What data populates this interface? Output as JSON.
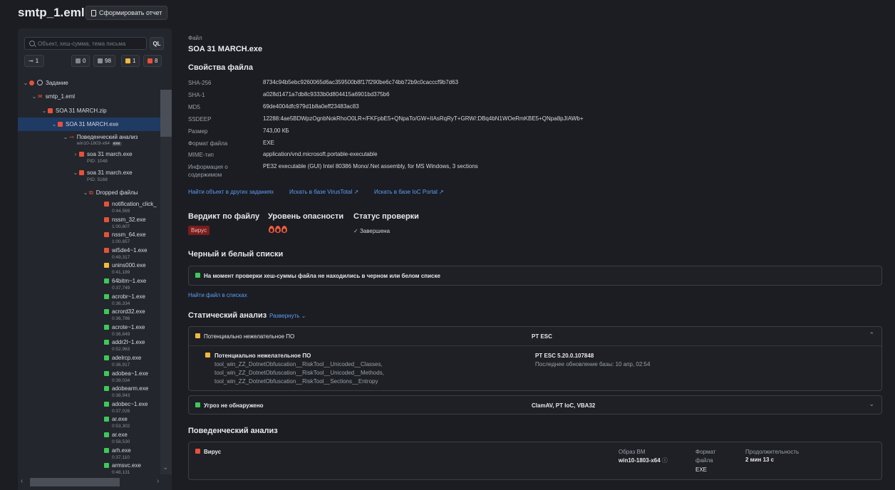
{
  "header": {
    "title": "smtp_1.eml",
    "report_button": "Сформировать отчет"
  },
  "sidebar": {
    "search_placeholder": "Объект, хеш-сумма, тема письма",
    "ql_label": "QL",
    "counters": [
      {
        "label": "1",
        "icon": "tree-icon"
      },
      {
        "label": "0",
        "color": "#8a8f99"
      },
      {
        "label": "98",
        "color": "#8a8f99"
      },
      {
        "label": "1",
        "color": "#f4b73e"
      },
      {
        "label": "8",
        "color": "#e8503a"
      }
    ],
    "tree": {
      "task": "Задание",
      "email": "smtp_1.eml",
      "zip": "SOA 31 MARCH.zip",
      "exe": "SOA 31 MARCH.exe",
      "behavior": "Поведенческий анализ",
      "behavior_env": "win10-1803-x64",
      "behavior_badge": "exe",
      "proc1": "soa 31 march.exe",
      "proc1_pid": "PID: 1048",
      "proc2": "soa 31 march.exe",
      "proc2_pid": "PID: 5168",
      "dropped": "Dropped файлы",
      "files": [
        {
          "name": "notification_click_",
          "time": "0:44,569",
          "color": "#e8503a"
        },
        {
          "name": "nssm_32.exe",
          "time": "1:00,607",
          "color": "#e8503a"
        },
        {
          "name": "nssm_64.exe",
          "time": "1:00,657",
          "color": "#e8503a"
        },
        {
          "name": "wi5de4~1.exe",
          "time": "0:49,317",
          "color": "#e8503a"
        },
        {
          "name": "unins000.exe",
          "time": "0:41,189",
          "color": "#f4b73e"
        },
        {
          "name": "64bitm~1.exe",
          "time": "0:37,749",
          "color": "#3ec85a"
        },
        {
          "name": "acrobr~1.exe",
          "time": "0:36,334",
          "color": "#3ec85a"
        },
        {
          "name": "acrord32.exe",
          "time": "0:36,786",
          "color": "#3ec85a"
        },
        {
          "name": "acrote~1.exe",
          "time": "0:36,849",
          "color": "#3ec85a"
        },
        {
          "name": "addr2l~1.exe",
          "time": "0:52,963",
          "color": "#3ec85a"
        },
        {
          "name": "adelrcp.exe",
          "time": "0:36,917",
          "color": "#3ec85a"
        },
        {
          "name": "adobea~1.exe",
          "time": "0:39,034",
          "color": "#3ec85a"
        },
        {
          "name": "adobearm.exe",
          "time": "0:38,943",
          "color": "#3ec85a"
        },
        {
          "name": "adobec~1.exe",
          "time": "0:37,026",
          "color": "#3ec85a"
        },
        {
          "name": "ar.exe",
          "time": "0:53,302",
          "color": "#3ec85a"
        },
        {
          "name": "ar.exe",
          "time": "0:58,530",
          "color": "#3ec85a"
        },
        {
          "name": "arh.exe",
          "time": "0:37,110",
          "color": "#3ec85a"
        },
        {
          "name": "armsvc.exe",
          "time": "0:48,131",
          "color": "#3ec85a"
        }
      ]
    }
  },
  "main": {
    "file_label": "Файл",
    "file_name": "SOA 31 MARCH.exe",
    "props_title": "Свойства файла",
    "props": [
      {
        "k": "SHA-256",
        "v": "8734c94b5ebc9260065d6ac359500b8f17f290be6c74bb72b9c0cacccf9b7d63"
      },
      {
        "k": "SHA-1",
        "v": "a028d1471a7db8c9333b0d804415a6901bd375b6"
      },
      {
        "k": "MD5",
        "v": "69de4004dfc979d1b8a0eff23483ac83"
      },
      {
        "k": "SSDEEP",
        "v": "12288:4ae5BDWpzOgnbNokRhoO0LR+/FKFpbE5+QNpaTo/GW+IIAsRqRyT+GRW/:DBq4bN1WOeRmKBE5+QNpa8pJIAWb+"
      },
      {
        "k": "Размер",
        "v": "743,00 КБ"
      },
      {
        "k": "Формат файла",
        "v": "EXE"
      },
      {
        "k": "MIME-тип",
        "v": "application/vnd.microsoft.portable-executable"
      },
      {
        "k": "Информация о содержимом",
        "v": "PE32 executable (GUI) Intel 80386 Mono/.Net assembly, for MS Windows, 3 sections"
      }
    ],
    "links": {
      "other_tasks": "Найти объект в других заданиях",
      "virustotal": "Искать в базе VirusTotal",
      "ioc": "Искать в базе IoC Portal"
    },
    "verdict": {
      "verdict_title": "Вердикт по файлу",
      "danger_title": "Уровень опасности",
      "status_title": "Статус проверки",
      "verdict_value": "Вирус",
      "status_value": "Завершена"
    },
    "lists": {
      "title": "Черный и белый списки",
      "message": "На момент проверки хеш-суммы файла не находились в черном или белом списке",
      "find_link": "Найти файл в списках"
    },
    "static": {
      "title": "Статический анализ",
      "expand": "Развернуть",
      "block1_title": "Потенциально нежелательное ПО",
      "block1_engine": "PT ESC",
      "block1_inner_title": "Потенциально нежелательное ПО",
      "block1_rules": [
        "tool_win_ZZ_DotnetObfuscation__RiskTool__Unicoded__Classes,",
        "tool_win_ZZ_DotnetObfuscation__RiskTool__Unicoded__Methods,",
        "tool_win_ZZ_DotnetObfuscation__RiskTool__Sections__Entropy"
      ],
      "block1_version": "PT ESC 5.20.0.107848",
      "block1_update": "Последнее обновление базы: 10 апр, 02:54",
      "block2_title": "Угроз не обнаружено",
      "block2_engines": "ClamAV, PT IoC, VBA32"
    },
    "behavior": {
      "title": "Поведенческий анализ",
      "verdict": "Вирус",
      "vm_label": "Образ ВМ",
      "vm_value": "win10-1803-x64",
      "format_label": "Формат файла",
      "format_value": "EXE",
      "duration_label": "Продолжительность",
      "duration_value": "2 мин 13 с"
    }
  }
}
